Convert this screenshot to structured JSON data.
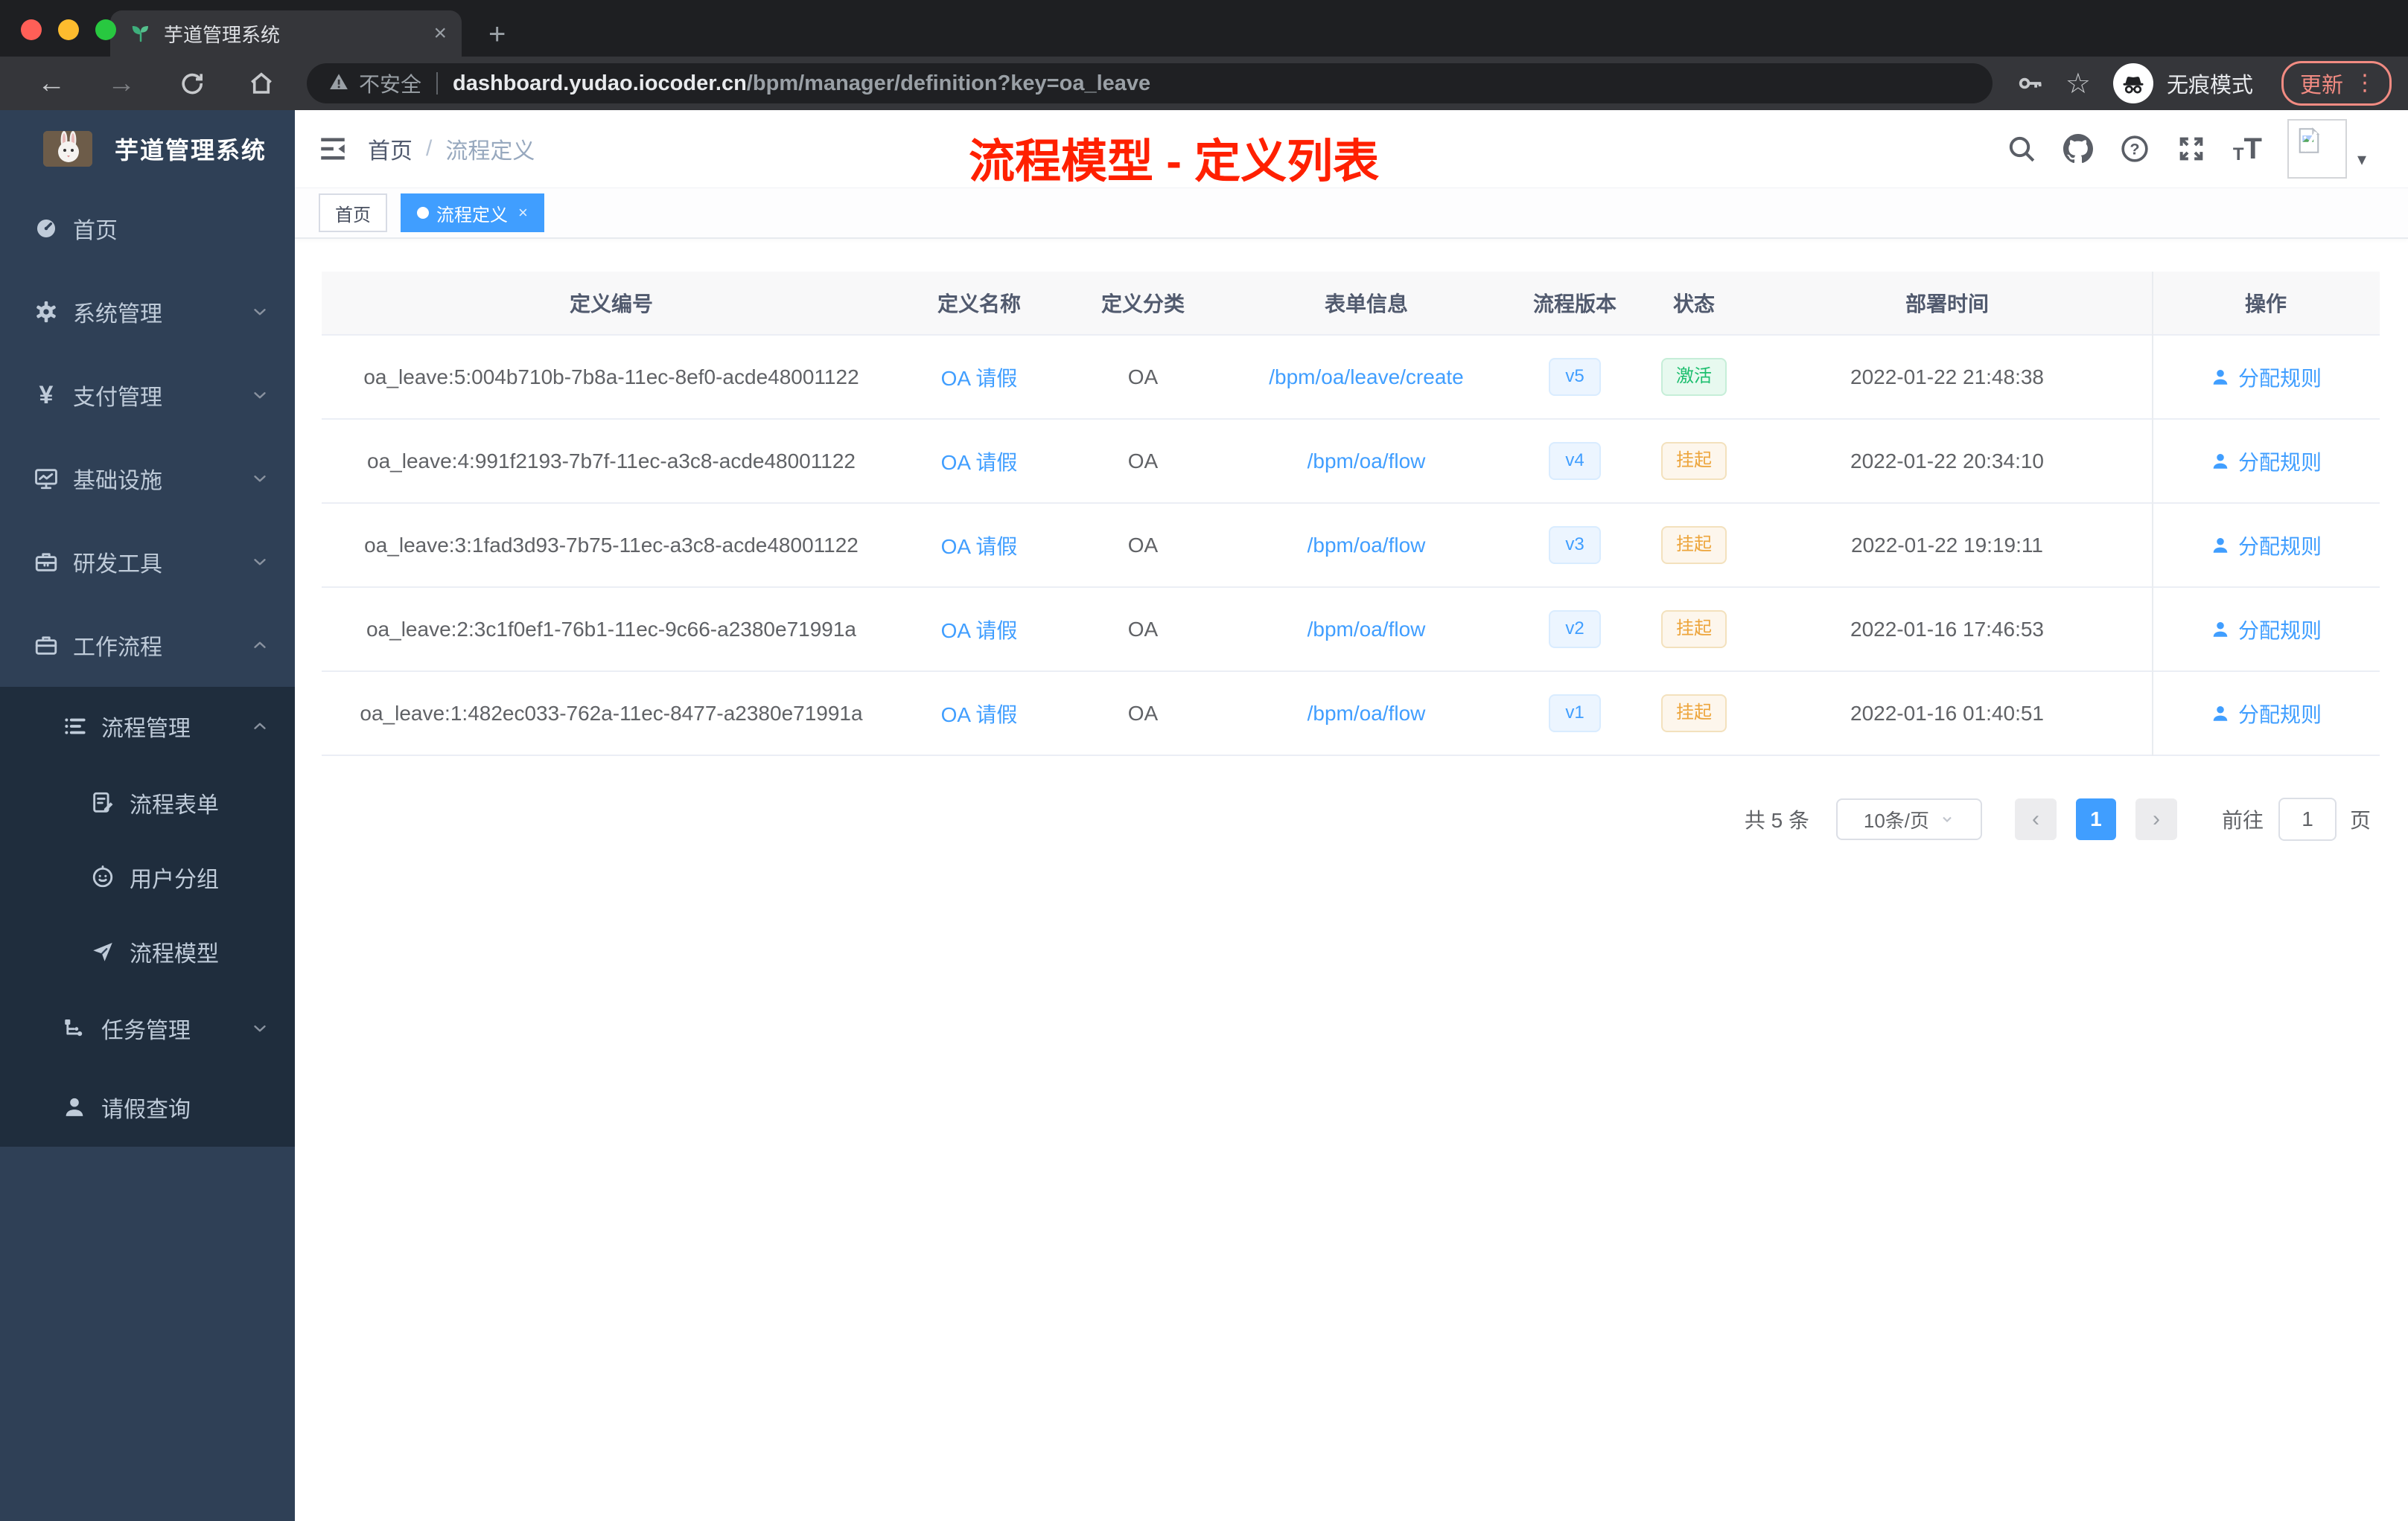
{
  "colors": {
    "accent": "#409eff",
    "success_text": "#1cbe6e",
    "warning_text": "#eda53c",
    "annotation_red": "#ff2000",
    "sidebar_bg": "#2f4056",
    "submenu_bg": "#1f2d3d"
  },
  "browser": {
    "tab": {
      "title": "芋道管理系统",
      "close": "×",
      "new_tab": "+"
    },
    "toolbar": {
      "security_label": "不安全",
      "url_host": "dashboard.yudao.iocoder.cn",
      "url_path": "/bpm/manager/definition?key=oa_leave",
      "incognito_label": "无痕模式",
      "update_label": "更新",
      "menu_dots": "⋮"
    }
  },
  "sidebar": {
    "logo_title": "芋道管理系统",
    "menu": [
      {
        "name": "home",
        "label": "首页",
        "icon": "dashboard-icon",
        "depth": 0
      },
      {
        "name": "system-management",
        "label": "系统管理",
        "icon": "gear-icon",
        "depth": 0,
        "chevron": "down"
      },
      {
        "name": "payment-management",
        "label": "支付管理",
        "icon": "yen-icon",
        "depth": 0,
        "chevron": "down"
      },
      {
        "name": "infrastructure",
        "label": "基础设施",
        "icon": "monitor-icon",
        "depth": 0,
        "chevron": "down"
      },
      {
        "name": "dev-tools",
        "label": "研发工具",
        "icon": "toolbox-icon",
        "depth": 0,
        "chevron": "down"
      },
      {
        "name": "workflow",
        "label": "工作流程",
        "icon": "briefcase-icon",
        "depth": 0,
        "chevron": "up"
      },
      {
        "name": "process-management",
        "label": "流程管理",
        "icon": "list-icon",
        "depth": 1,
        "chevron": "up",
        "dark": true
      },
      {
        "name": "process-form",
        "label": "流程表单",
        "icon": "form-icon",
        "depth": 2,
        "dark": true
      },
      {
        "name": "user-group",
        "label": "用户分组",
        "icon": "users-icon",
        "depth": 2,
        "dark": true
      },
      {
        "name": "process-model",
        "label": "流程模型",
        "icon": "send-icon",
        "depth": 2,
        "dark": true
      },
      {
        "name": "task-management",
        "label": "任务管理",
        "icon": "tree-icon",
        "depth": 1,
        "chevron": "down",
        "dark": true
      },
      {
        "name": "leave-query",
        "label": "请假查询",
        "icon": "user-icon",
        "depth": 1,
        "dark": true
      }
    ]
  },
  "header": {
    "breadcrumb_home": "首页",
    "breadcrumb_sep": "/",
    "breadcrumb_current": "流程定义",
    "annotation": "流程模型 - 定义列表",
    "avatar_caret": "▾"
  },
  "tags": [
    {
      "label": "首页",
      "active": false
    },
    {
      "label": "流程定义",
      "active": true,
      "close": "×"
    }
  ],
  "table": {
    "columns": [
      "定义编号",
      "定义名称",
      "定义分类",
      "表单信息",
      "流程版本",
      "状态",
      "部署时间",
      "操作"
    ],
    "action_label": "分配规则",
    "rows": [
      {
        "id": "oa_leave:5:004b710b-7b8a-11ec-8ef0-acde48001122",
        "name": "OA 请假",
        "category": "OA",
        "form": "/bpm/oa/leave/create",
        "version": "v5",
        "status": "激活",
        "status_type": "success",
        "time": "2022-01-22 21:48:38"
      },
      {
        "id": "oa_leave:4:991f2193-7b7f-11ec-a3c8-acde48001122",
        "name": "OA 请假",
        "category": "OA",
        "form": "/bpm/oa/flow",
        "version": "v4",
        "status": "挂起",
        "status_type": "warning",
        "time": "2022-01-22 20:34:10"
      },
      {
        "id": "oa_leave:3:1fad3d93-7b75-11ec-a3c8-acde48001122",
        "name": "OA 请假",
        "category": "OA",
        "form": "/bpm/oa/flow",
        "version": "v3",
        "status": "挂起",
        "status_type": "warning",
        "time": "2022-01-22 19:19:11"
      },
      {
        "id": "oa_leave:2:3c1f0ef1-76b1-11ec-9c66-a2380e71991a",
        "name": "OA 请假",
        "category": "OA",
        "form": "/bpm/oa/flow",
        "version": "v2",
        "status": "挂起",
        "status_type": "warning",
        "time": "2022-01-16 17:46:53"
      },
      {
        "id": "oa_leave:1:482ec033-762a-11ec-8477-a2380e71991a",
        "name": "OA 请假",
        "category": "OA",
        "form": "/bpm/oa/flow",
        "version": "v1",
        "status": "挂起",
        "status_type": "warning",
        "time": "2022-01-16 01:40:51"
      }
    ]
  },
  "pagination": {
    "total": "共 5 条",
    "page_size": "10条/页",
    "prev": "‹",
    "current": "1",
    "next": "›",
    "goto_label": "前往",
    "goto_value": "1",
    "page_unit": "页"
  }
}
